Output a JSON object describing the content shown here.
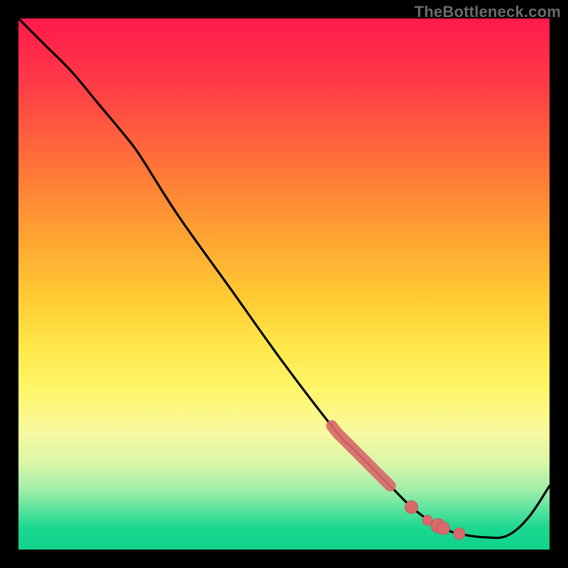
{
  "watermark": "TheBottleneck.com",
  "colors": {
    "frame": "#000000",
    "curve": "#000000",
    "marker": "#d86a6a",
    "marker_stroke": "#c65a5a"
  },
  "chart_data": {
    "type": "line",
    "title": "",
    "xlabel": "",
    "ylabel": "",
    "xlim": [
      0,
      100
    ],
    "ylim": [
      0,
      100
    ],
    "grid": false,
    "legend": false,
    "series": [
      {
        "name": "bottleneck-curve",
        "x": [
          0,
          5,
          10,
          15,
          20,
          23,
          30,
          40,
          50,
          60,
          63,
          66,
          70,
          74,
          78,
          80,
          82,
          85,
          88,
          92,
          96,
          100
        ],
        "y": [
          100,
          95,
          90,
          84,
          78,
          74,
          63,
          49,
          35,
          22,
          19,
          16,
          12,
          8,
          5,
          4,
          3.2,
          2.6,
          2.3,
          2.6,
          6,
          12
        ]
      }
    ],
    "highlight_segment": {
      "series": "bottleneck-curve",
      "x_start": 59,
      "x_end": 70,
      "style": "thick-red"
    },
    "markers": [
      {
        "x": 74,
        "y": 8,
        "size": 9
      },
      {
        "x": 77,
        "y": 5.5,
        "size": 7
      },
      {
        "x": 79,
        "y": 4.5,
        "size": 10
      },
      {
        "x": 80,
        "y": 4,
        "size": 9
      },
      {
        "x": 83,
        "y": 3,
        "size": 8
      }
    ]
  }
}
